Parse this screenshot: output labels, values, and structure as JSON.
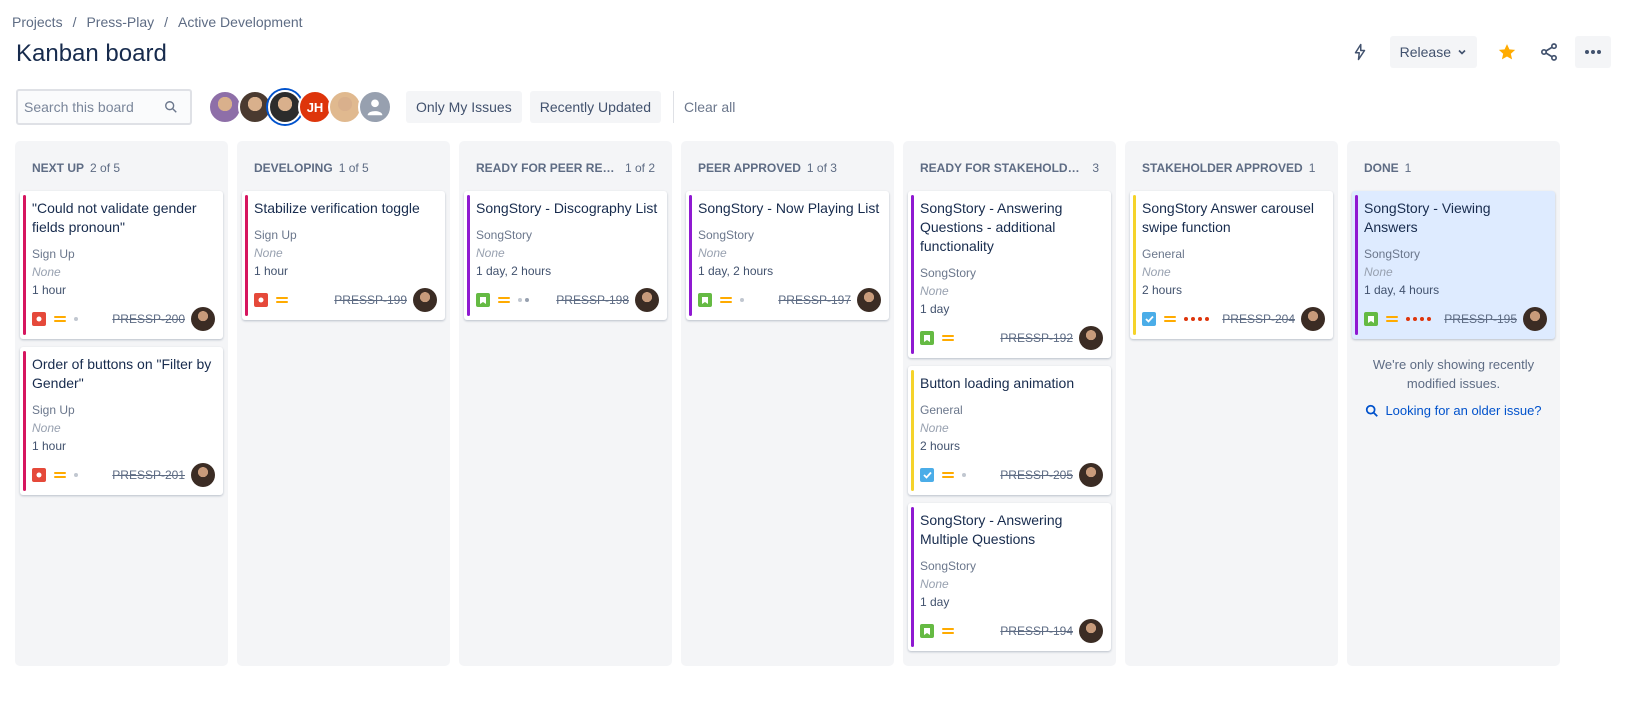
{
  "breadcrumb": [
    "Projects",
    "Press-Play",
    "Active Development"
  ],
  "page_title": "Kanban board",
  "header": {
    "release_label": "Release"
  },
  "search": {
    "placeholder": "Search this board"
  },
  "avatars": [
    {
      "name": "user-avatar-1",
      "initials": "",
      "color": "#8e6fa8"
    },
    {
      "name": "user-avatar-2",
      "initials": "",
      "color": "#4a3a30"
    },
    {
      "name": "user-avatar-3",
      "initials": "",
      "color": "#2c2c2c"
    },
    {
      "name": "user-avatar-jh",
      "initials": "JH",
      "color": "#de350b"
    },
    {
      "name": "user-avatar-5",
      "initials": "",
      "color": "#e0b98f"
    },
    {
      "name": "user-avatar-unassigned",
      "initials": "",
      "color": "#97a0af"
    }
  ],
  "filters": {
    "only_my_issues": "Only My Issues",
    "recently_updated": "Recently Updated",
    "clear_all": "Clear all"
  },
  "colors": {
    "bug": "#e5493a",
    "story": "#65ba43",
    "task": "#4bade8",
    "priority_medium": "#ffab00",
    "stripe_pink": "#d6165f",
    "stripe_purple": "#8f19d1",
    "stripe_yellow": "#f5d32a"
  },
  "columns": [
    {
      "name": "NEXT UP",
      "count": "2 of 5",
      "cards": [
        {
          "title": "\"Could not validate gender fields pronoun\"",
          "epic": "Sign Up",
          "fix": "None",
          "time": "1 hour",
          "type": "bug",
          "stripe": "#d6165f",
          "dots": [
            "#c1c7d0"
          ],
          "key": "PRESSP-200"
        },
        {
          "title": "Order of buttons on \"Filter by Gender\"",
          "epic": "Sign Up",
          "fix": "None",
          "time": "1 hour",
          "type": "bug",
          "stripe": "#d6165f",
          "dots": [
            "#c1c7d0"
          ],
          "key": "PRESSP-201"
        }
      ]
    },
    {
      "name": "DEVELOPING",
      "count": "1 of 5",
      "cards": [
        {
          "title": "Stabilize verification toggle",
          "epic": "Sign Up",
          "fix": "None",
          "time": "1 hour",
          "type": "bug",
          "stripe": "#d6165f",
          "dots": [],
          "key": "PRESSP-199"
        }
      ]
    },
    {
      "name": "READY FOR PEER REVIEW",
      "count": "1 of 2",
      "cards": [
        {
          "title": "SongStory - Discography List",
          "epic": "SongStory",
          "fix": "None",
          "time": "1 day, 2 hours",
          "type": "story",
          "stripe": "#8f19d1",
          "dots": [
            "#c1c7d0",
            "#97a0af"
          ],
          "key": "PRESSP-198"
        }
      ]
    },
    {
      "name": "PEER APPROVED",
      "count": "1 of 3",
      "cards": [
        {
          "title": "SongStory - Now Playing List",
          "epic": "SongStory",
          "fix": "None",
          "time": "1 day, 2 hours",
          "type": "story",
          "stripe": "#8f19d1",
          "dots": [
            "#c1c7d0"
          ],
          "key": "PRESSP-197"
        }
      ]
    },
    {
      "name": "READY FOR STAKEHOLDER RE...",
      "count": "3",
      "cards": [
        {
          "title": "SongStory - Answering Questions - additional functionality",
          "epic": "SongStory",
          "fix": "None",
          "time": "1 day",
          "type": "story",
          "stripe": "#8f19d1",
          "dots": [],
          "key": "PRESSP-192"
        },
        {
          "title": "Button loading animation",
          "epic": "General",
          "fix": "None",
          "time": "2 hours",
          "type": "task",
          "stripe": "#f5d32a",
          "dots": [
            "#c1c7d0"
          ],
          "key": "PRESSP-205"
        },
        {
          "title": "SongStory - Answering Multiple Questions",
          "epic": "SongStory",
          "fix": "None",
          "time": "1 day",
          "type": "story",
          "stripe": "#8f19d1",
          "dots": [],
          "key": "PRESSP-194"
        }
      ]
    },
    {
      "name": "STAKEHOLDER APPROVED",
      "count": "1",
      "cards": [
        {
          "title": "SongStory Answer carousel swipe function",
          "epic": "General",
          "fix": "None",
          "time": "2 hours",
          "type": "task",
          "stripe": "#f5d32a",
          "dots": [
            "#de350b",
            "#de350b",
            "#de350b",
            "#de350b"
          ],
          "key": "PRESSP-204"
        }
      ]
    },
    {
      "name": "DONE",
      "count": "1",
      "cards": [
        {
          "title": "SongStory - Viewing Answers",
          "epic": "SongStory",
          "fix": "None",
          "time": "1 day, 4 hours",
          "type": "story",
          "stripe": "#8f19d1",
          "dots": [
            "#de350b",
            "#de350b",
            "#de350b",
            "#de350b"
          ],
          "key": "PRESSP-195",
          "highlight": true
        }
      ],
      "note": "We're only showing recently modified issues.",
      "link": "Looking for an older issue?"
    }
  ]
}
